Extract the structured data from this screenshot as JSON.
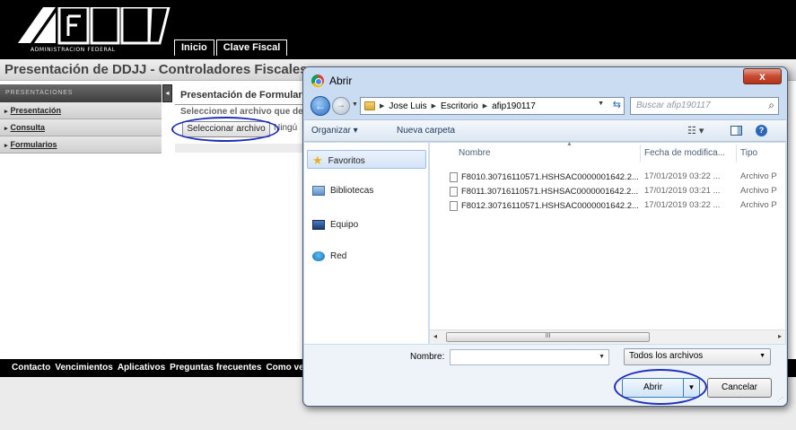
{
  "header": {
    "logo_text": "ADMINISTRACION FEDERAL",
    "tabs": [
      {
        "label": "Inicio"
      },
      {
        "label": "Clave Fiscal"
      }
    ]
  },
  "page": {
    "title": "Presentación de DDJJ - Controladores Fiscales"
  },
  "sidebar": {
    "header": "PRESENTACIONES",
    "toggle": "◂",
    "items": [
      {
        "label": "Presentación"
      },
      {
        "label": "Consulta"
      },
      {
        "label": "Formularios"
      }
    ]
  },
  "main": {
    "title": "Presentación de Formulario",
    "subtitle": "Seleccione el archivo que de",
    "file_button": "Seleccionar archivo",
    "file_status": "Ningú"
  },
  "footer": {
    "links": [
      "Contacto",
      "Vencimientos",
      "Aplicativos",
      "Preguntas frecuentes",
      "Como ver e"
    ]
  },
  "dialog": {
    "title": "Abrir",
    "close_label": "x",
    "address": {
      "crumbs": [
        "Jose Luis",
        "Escritorio",
        "afip190117"
      ]
    },
    "search_placeholder": "Buscar afip190117",
    "toolbar": {
      "organize": "Organizar ▾",
      "new_folder": "Nueva carpeta",
      "view": "☷ ▾",
      "help": "?"
    },
    "nav": [
      {
        "label": "Favoritos",
        "icon": "star-icon"
      },
      {
        "label": "Bibliotecas",
        "icon": "library-icon"
      },
      {
        "label": "Equipo",
        "icon": "computer-icon"
      },
      {
        "label": "Red",
        "icon": "network-icon"
      }
    ],
    "columns": {
      "name": "Nombre",
      "date": "Fecha de modifica...",
      "type": "Tipo"
    },
    "files": [
      {
        "name": "F8010.30716110571.HSHSAC0000001642.2...",
        "date": "17/01/2019 03:22 ...",
        "type": "Archivo P"
      },
      {
        "name": "F8011.30716110571.HSHSAC0000001642.2...",
        "date": "17/01/2019 03:21 ...",
        "type": "Archivo P"
      },
      {
        "name": "F8012.30716110571.HSHSAC0000001642.2...",
        "date": "17/01/2019 03:22 ...",
        "type": "Archivo P"
      }
    ],
    "scroll_thumb": "III",
    "name_label": "Nombre:",
    "name_value": "",
    "filter": "Todos los archivos",
    "open_label": "Abrir",
    "cancel_label": "Cancelar"
  }
}
